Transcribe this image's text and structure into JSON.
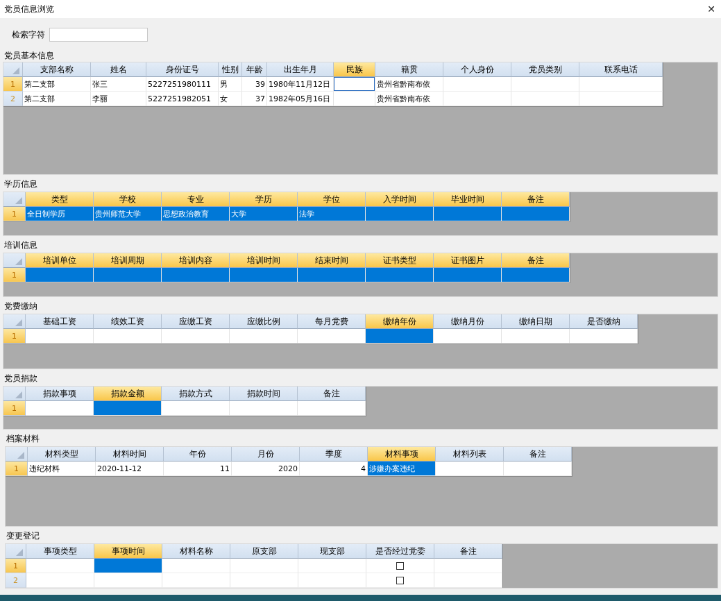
{
  "window": {
    "title": "党员信息浏览",
    "close": "✕"
  },
  "search": {
    "label": "检索字符"
  },
  "sections": [
    {
      "title": "党员基本信息",
      "editing": true,
      "columns": [
        {
          "label": "支部名称",
          "active": false
        },
        {
          "label": "姓名",
          "active": false
        },
        {
          "label": "身份证号",
          "active": false
        },
        {
          "label": "性别",
          "active": false
        },
        {
          "label": "年龄",
          "active": false
        },
        {
          "label": "出生年月",
          "active": false
        },
        {
          "label": "民族",
          "active": true
        },
        {
          "label": "籍贯",
          "active": false
        },
        {
          "label": "个人身份",
          "active": false
        },
        {
          "label": "党员类别",
          "active": false
        },
        {
          "label": "联系电话",
          "active": false
        }
      ],
      "rows": [
        {
          "number": "1",
          "current": true,
          "cells": [
            {
              "text": "第二支部",
              "selected": false
            },
            {
              "text": "张三",
              "selected": false
            },
            {
              "text": "5227251980111",
              "selected": false
            },
            {
              "text": "男",
              "selected": false
            },
            {
              "text": "39",
              "selected": false
            },
            {
              "text": "1980年11月12日",
              "selected": false
            },
            {
              "selected": true
            },
            {
              "text": "贵州省黔南布依",
              "selected": false
            },
            {
              "selected": false
            },
            {
              "selected": false
            },
            {
              "selected": false
            }
          ]
        },
        {
          "number": "2",
          "current": false,
          "cells": [
            {
              "text": "第二支部",
              "selected": false
            },
            {
              "text": "李丽",
              "selected": false
            },
            {
              "text": "5227251982051",
              "selected": false
            },
            {
              "text": "女",
              "selected": false
            },
            {
              "text": "37",
              "selected": false
            },
            {
              "text": "1982年05月16日",
              "selected": false
            },
            {
              "selected": false
            },
            {
              "text": "贵州省黔南布依",
              "selected": false
            },
            {
              "selected": false
            },
            {
              "selected": false
            },
            {
              "selected": false
            }
          ]
        }
      ]
    },
    {
      "title": "学历信息",
      "editing": false,
      "columns": [
        {
          "label": "类型",
          "active": true
        },
        {
          "label": "学校",
          "active": true
        },
        {
          "label": "专业",
          "active": true
        },
        {
          "label": "学历",
          "active": true
        },
        {
          "label": "学位",
          "active": true
        },
        {
          "label": "入学时间",
          "active": true
        },
        {
          "label": "毕业时间",
          "active": true
        },
        {
          "label": "备注",
          "active": true
        }
      ],
      "rows": [
        {
          "number": "1",
          "current": true,
          "cells": [
            {
              "text": "全日制学历",
              "selected": true
            },
            {
              "text": "贵州师范大学",
              "selected": true
            },
            {
              "text": "思想政治教育",
              "selected": true
            },
            {
              "text": "大学",
              "selected": true
            },
            {
              "text": "法学",
              "selected": true
            },
            {
              "selected": true
            },
            {
              "selected": true
            },
            {
              "selected": true
            }
          ]
        }
      ]
    },
    {
      "title": "培训信息",
      "editing": false,
      "columns": [
        {
          "label": "培训单位",
          "active": true
        },
        {
          "label": "培训周期",
          "active": true
        },
        {
          "label": "培训内容",
          "active": true
        },
        {
          "label": "培训时间",
          "active": true
        },
        {
          "label": "结束时间",
          "active": true
        },
        {
          "label": "证书类型",
          "active": true
        },
        {
          "label": "证书图片",
          "active": true
        },
        {
          "label": "备注",
          "active": true
        }
      ],
      "rows": [
        {
          "number": "1",
          "current": true,
          "cells": [
            {
              "selected": true
            },
            {
              "selected": true
            },
            {
              "selected": true
            },
            {
              "selected": true
            },
            {
              "selected": true
            },
            {
              "selected": true
            },
            {
              "selected": true
            },
            {
              "selected": true
            }
          ]
        }
      ]
    },
    {
      "title": "党费缴纳",
      "editing": false,
      "columns": [
        {
          "label": "基础工资",
          "active": false
        },
        {
          "label": "绩效工资",
          "active": false
        },
        {
          "label": "应缴工资",
          "active": false
        },
        {
          "label": "应缴比例",
          "active": false
        },
        {
          "label": "每月党费",
          "active": false
        },
        {
          "label": "缴纳年份",
          "active": true
        },
        {
          "label": "缴纳月份",
          "active": false
        },
        {
          "label": "缴纳日期",
          "active": false
        },
        {
          "label": "是否缴纳",
          "active": false
        }
      ],
      "rows": [
        {
          "number": "1",
          "current": true,
          "cells": [
            {
              "selected": false
            },
            {
              "selected": false
            },
            {
              "selected": false
            },
            {
              "selected": false
            },
            {
              "selected": false
            },
            {
              "selected": true
            },
            {
              "selected": false
            },
            {
              "selected": false
            },
            {
              "selected": false
            }
          ]
        }
      ]
    },
    {
      "title": "党员捐款",
      "editing": false,
      "columns": [
        {
          "label": "捐款事项",
          "active": false
        },
        {
          "label": "捐款金额",
          "active": true
        },
        {
          "label": "捐款方式",
          "active": false
        },
        {
          "label": "捐款时间",
          "active": false
        },
        {
          "label": "备注",
          "active": false
        }
      ],
      "rows": [
        {
          "number": "1",
          "current": true,
          "cells": [
            {
              "selected": false
            },
            {
              "selected": true
            },
            {
              "selected": false
            },
            {
              "selected": false
            },
            {
              "selected": false
            }
          ]
        }
      ]
    },
    {
      "title": "档案材料",
      "editing": false,
      "columns": [
        {
          "label": "材料类型",
          "active": false
        },
        {
          "label": "材料时间",
          "active": false
        },
        {
          "label": "年份",
          "active": false
        },
        {
          "label": "月份",
          "active": false
        },
        {
          "label": "季度",
          "active": false
        },
        {
          "label": "材料事项",
          "active": true
        },
        {
          "label": "材料列表",
          "active": false
        },
        {
          "label": "备注",
          "active": false
        }
      ],
      "rows": [
        {
          "number": "1",
          "current": true,
          "cells": [
            {
              "text": "违纪材料",
              "selected": false
            },
            {
              "text": "2020-11-12",
              "selected": false
            },
            {
              "text": "11",
              "selected": false
            },
            {
              "text": "2020",
              "selected": false
            },
            {
              "text": "4",
              "selected": false
            },
            {
              "text": "涉嫌办案违纪",
              "selected": true
            },
            {
              "selected": false
            },
            {
              "selected": false
            }
          ]
        }
      ]
    },
    {
      "title": "变更登记",
      "editing": false,
      "columns": [
        {
          "label": "事项类型",
          "active": false
        },
        {
          "label": "事项时间",
          "active": true
        },
        {
          "label": "材料名称",
          "active": false
        },
        {
          "label": "原支部",
          "active": false
        },
        {
          "label": "现支部",
          "active": false
        },
        {
          "label": "是否经过党委",
          "active": false
        },
        {
          "label": "备注",
          "active": false
        }
      ],
      "rows": [
        {
          "number": "1",
          "current": true,
          "cells": [
            {
              "selected": false
            },
            {
              "selected": true
            },
            {
              "selected": false
            },
            {
              "selected": false
            },
            {
              "selected": false
            },
            {
              "selected": false,
              "checked": false
            },
            {
              "selected": false
            }
          ]
        },
        {
          "number": "2",
          "current": false,
          "cells": [
            {
              "selected": false
            },
            {
              "selected": false
            },
            {
              "selected": false
            },
            {
              "selected": false
            },
            {
              "selected": false
            },
            {
              "selected": false,
              "checked": false
            },
            {
              "selected": false
            }
          ]
        }
      ]
    }
  ]
}
